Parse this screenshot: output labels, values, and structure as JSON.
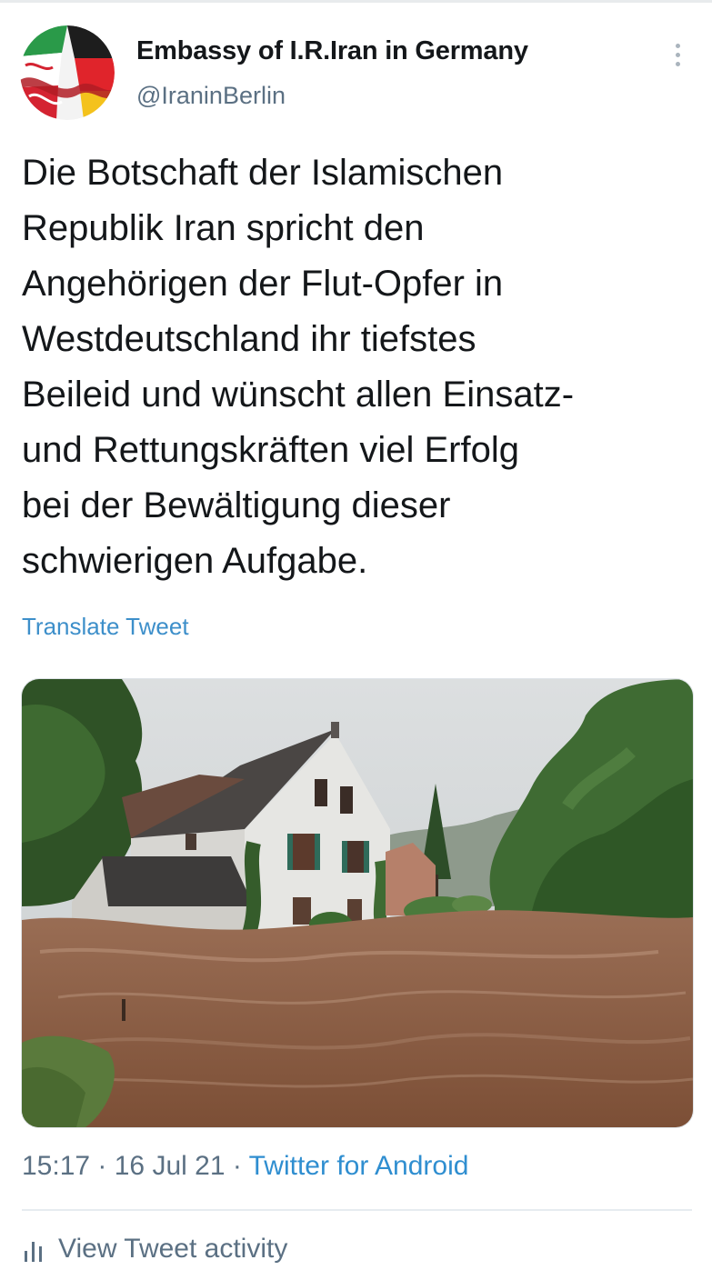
{
  "account": {
    "display_name": "Embassy of I.R.Iran in Germany",
    "handle": "@IraninBerlin",
    "avatar_icon": "iran-germany-flag-avatar"
  },
  "menu": {
    "icon": "vertical-dots-icon"
  },
  "tweet": {
    "text_lines": [
      "Die Botschaft der Islamischen",
      "Republik Iran spricht den",
      "Angehörigen der Flut-Opfer in",
      "Westdeutschland ihr tiefstes",
      "Beileid und wünscht allen Einsatz-",
      "und Rettungskräften viel Erfolg",
      "bei der Bewältigung dieser",
      "schwierigen Aufgabe."
    ],
    "translate_label": "Translate Tweet",
    "media_description_icon": "flooded-house-photo"
  },
  "meta": {
    "time": "15:17",
    "separator": " · ",
    "date": "16 Jul 21",
    "source": "Twitter for Android"
  },
  "activity": {
    "label": "View Tweet activity",
    "icon": "bar-chart-icon"
  },
  "colors": {
    "link_blue": "#3d8fca",
    "secondary_text": "#5b7083",
    "primary_text": "#14171a",
    "divider": "#e6ecf0"
  }
}
